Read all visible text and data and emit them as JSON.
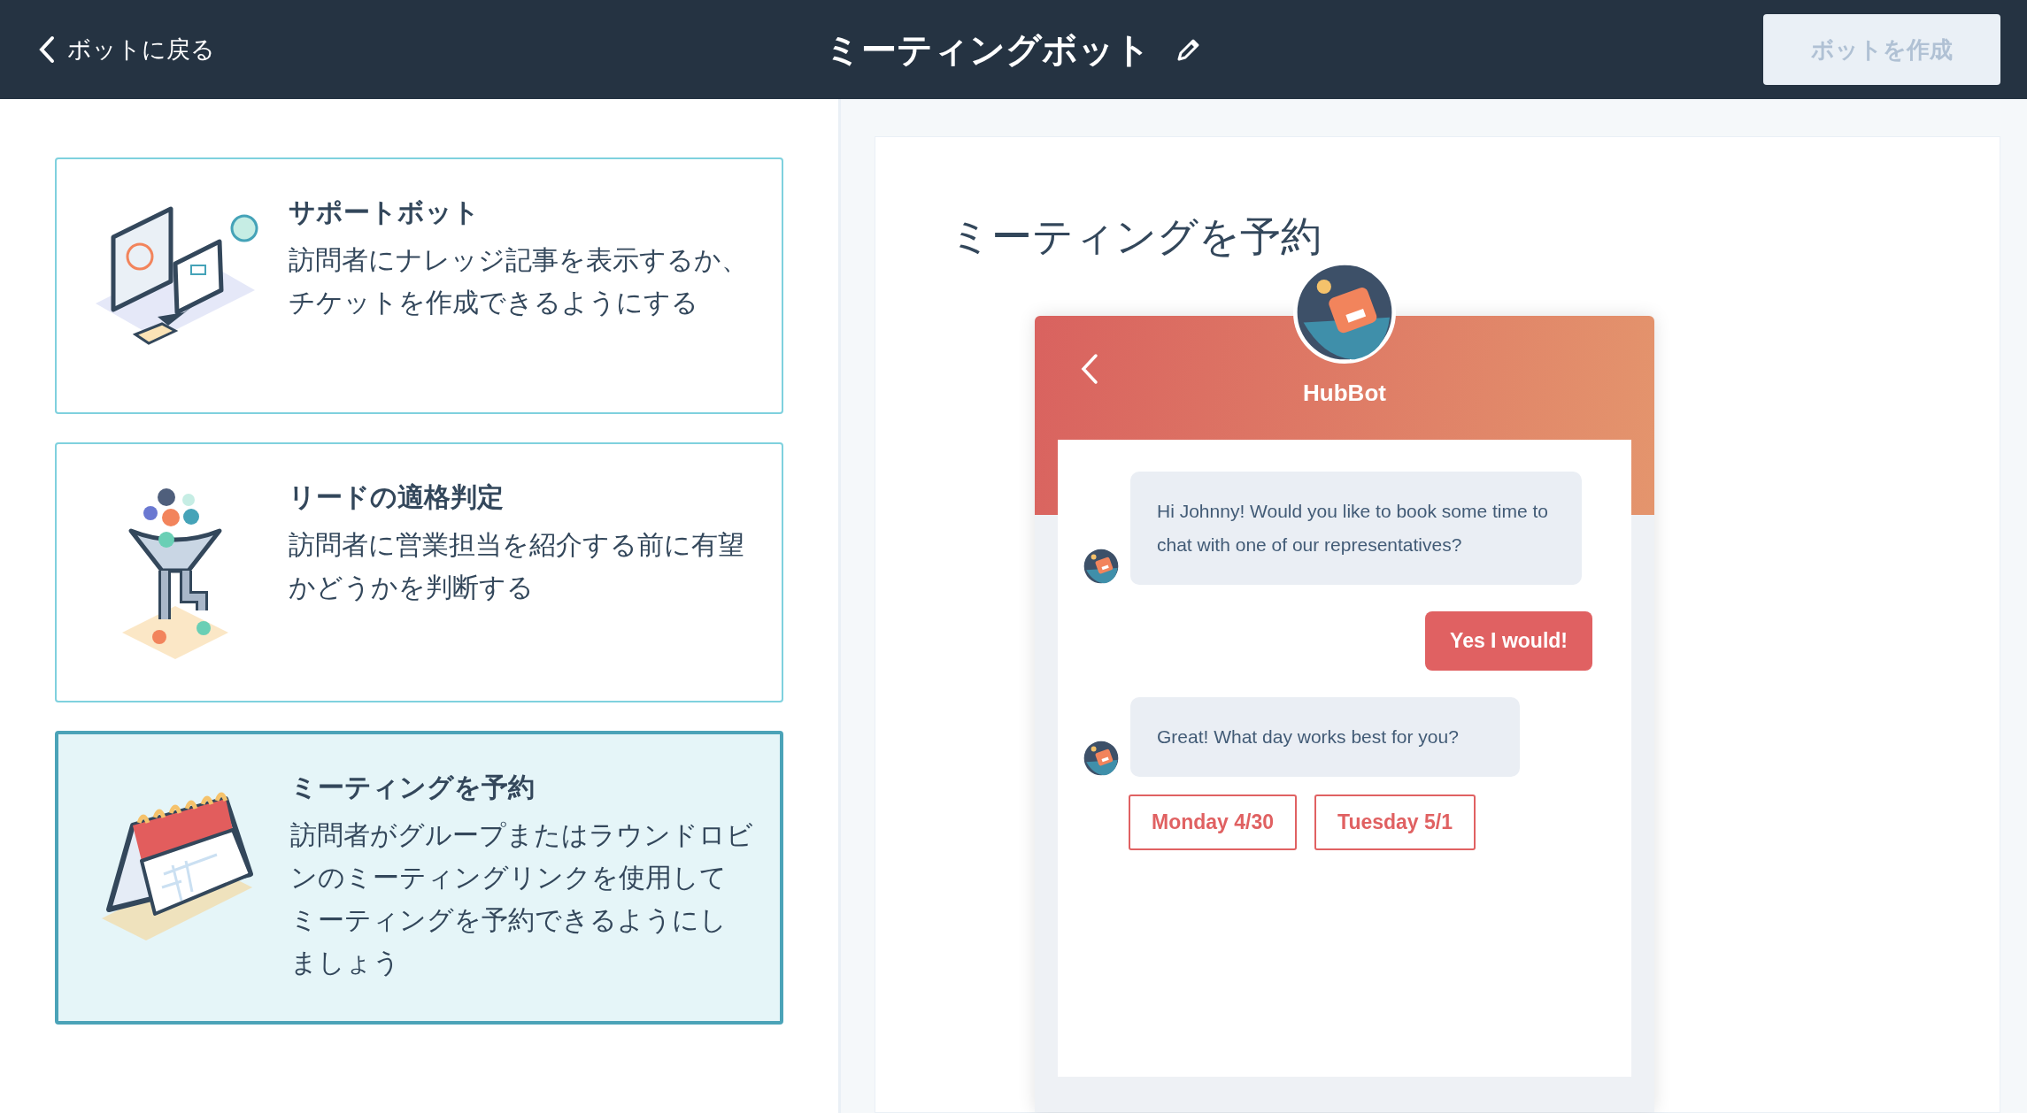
{
  "header": {
    "back_link": "ボットに戻る",
    "title": "ミーティングボット",
    "create_button": {
      "label": "ボットを作成",
      "disabled": true
    }
  },
  "templates": [
    {
      "kind": "support",
      "title": "サポートボット",
      "description": "訪問者にナレッジ記事を表示するか、チケットを作成できるようにする",
      "selected": false
    },
    {
      "kind": "qualify",
      "title": "リードの適格判定",
      "description": "訪問者に営業担当を紹介する前に有望かどうかを判断する",
      "selected": false
    },
    {
      "kind": "meeting",
      "title": "ミーティングを予約",
      "description": "訪問者がグループまたはラウンドロビンのミーティングリンクを使用してミーティングを予約できるようにしましょう",
      "selected": true
    }
  ],
  "preview": {
    "title": "ミーティングを予約",
    "chat": {
      "bot_name": "HubBot",
      "messages": [
        {
          "kind": "bot",
          "text": "Hi Johnny! Would you like to book some time to chat with one of our representatives?"
        },
        {
          "kind": "user",
          "text": "Yes I would!"
        },
        {
          "kind": "bot",
          "text": "Great!  What day works best for you?"
        }
      ],
      "quick_replies": [
        "Monday 4/30",
        "Tuesday 5/1"
      ]
    }
  }
}
